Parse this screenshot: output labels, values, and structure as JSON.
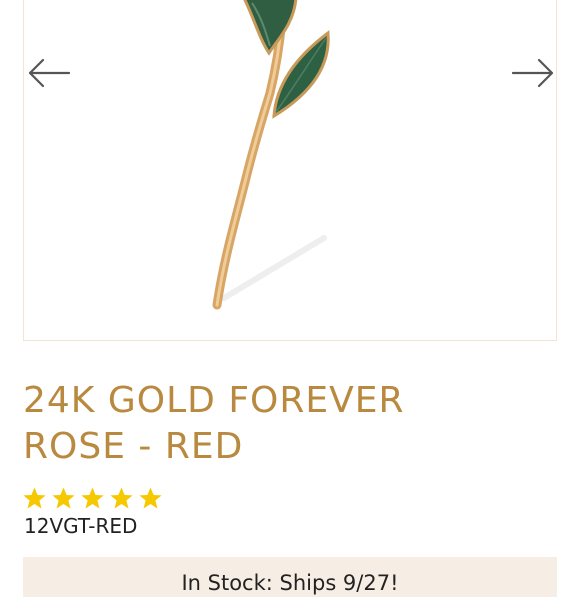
{
  "product": {
    "title_line1": "24K GOLD FOREVER",
    "title_line2": "ROSE - RED",
    "rating_stars": 5,
    "rating_max": 5,
    "sku": "12VGT-RED",
    "stock_text": "In Stock: Ships 9/27!"
  },
  "gallery": {
    "prev_icon": "arrow-left-icon",
    "next_icon": "arrow-right-icon"
  },
  "colors": {
    "accent": "#b8893e",
    "star": "#f6c800",
    "stock_bg": "#f6eee4",
    "border": "#f1e6d2"
  }
}
